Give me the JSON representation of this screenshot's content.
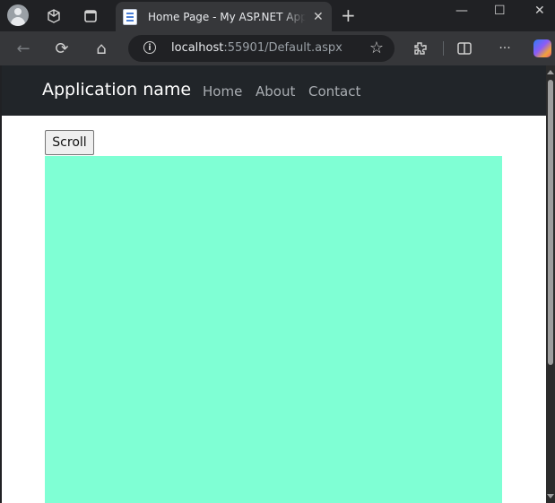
{
  "browser": {
    "tab": {
      "title": "Home Page - My ASP.NET Application",
      "close_glyph": "✕"
    },
    "new_tab_glyph": "+",
    "window_controls": {
      "minimize": "—",
      "maximize": "☐",
      "close": "✕"
    },
    "address_bar": {
      "host": "localhost",
      "rest": ":55901/Default.aspx"
    },
    "icons": {
      "back": "←",
      "refresh": "⟳",
      "home": "⌂",
      "info": "i",
      "favorite": "☆",
      "extensions": "⚙",
      "split": "◫",
      "more": "···"
    }
  },
  "page": {
    "brand": "Application name",
    "nav": [
      "Home",
      "About",
      "Contact"
    ],
    "scroll_button_label": "Scroll",
    "box_color": "#7fffd4",
    "navbar_color": "#212529"
  }
}
